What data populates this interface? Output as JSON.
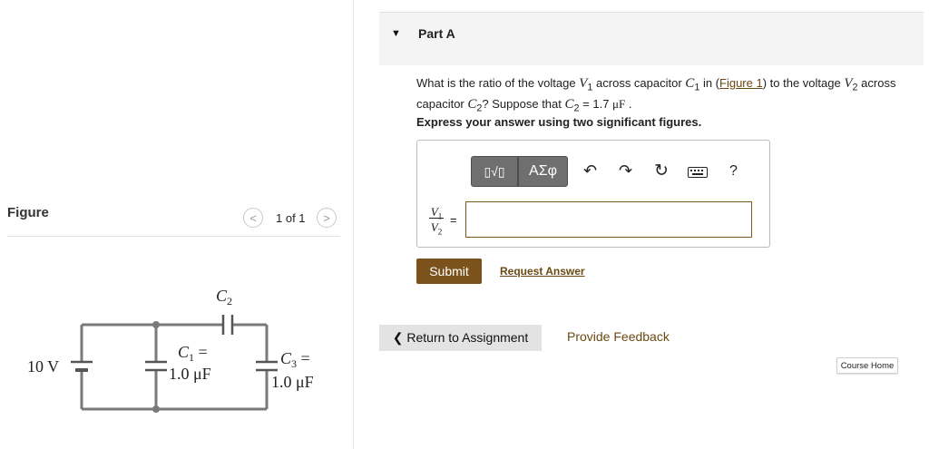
{
  "figure_panel": {
    "title": "Figure",
    "counter": "1 of 1",
    "prev_glyph": "<",
    "next_glyph": ">",
    "circuit": {
      "source_label": "10 V",
      "c1_label": "C",
      "c1_sub": "1",
      "c1_eq": " =",
      "c1_value": "1.0 μF",
      "c2_label": "C",
      "c2_sub": "2",
      "c3_label": "C",
      "c3_sub": "3",
      "c3_eq": " =",
      "c3_value": "1.0 μF"
    }
  },
  "part": {
    "title": "Part A",
    "question": {
      "t1": "What is the ratio of the voltage ",
      "v1": "V",
      "v1_sub": "1",
      "t2": " across capacitor ",
      "c1": "C",
      "c1_sub": "1",
      "t3": " in (",
      "fig_link": "Figure 1",
      "t4": ") to the voltage ",
      "v2": "V",
      "v2_sub": "2",
      "t5": " across capacitor ",
      "c2": "C",
      "c2_sub": "2",
      "t6": "? Suppose that ",
      "c2b": "C",
      "c2b_sub": "2",
      "t7": " = 1.7 ",
      "unit": "μF",
      "t8": " ."
    },
    "instruction": "Express your answer using two significant figures.",
    "toolbar": {
      "template_glyph": "▯√▯",
      "greek_label": "ΑΣφ",
      "undo_glyph": "↶",
      "redo_glyph": "↷",
      "reset_glyph": "↻",
      "help_label": "?"
    },
    "answer_label": {
      "num": "V",
      "num_sub": "1",
      "den": "V",
      "den_sub": "2",
      "eq": "="
    },
    "answer_value": "",
    "submit_label": "Submit",
    "request_answer_label": "Request Answer"
  },
  "footer": {
    "return_label": "❮ Return to Assignment",
    "feedback_label": "Provide Feedback",
    "course_home_label": "Course Home"
  },
  "colors": {
    "accent_brown": "#7b521c",
    "link_brown": "#6a4a12",
    "header_bg": "#f4f4f4",
    "toolbar_dark": "#6f6f6f"
  }
}
